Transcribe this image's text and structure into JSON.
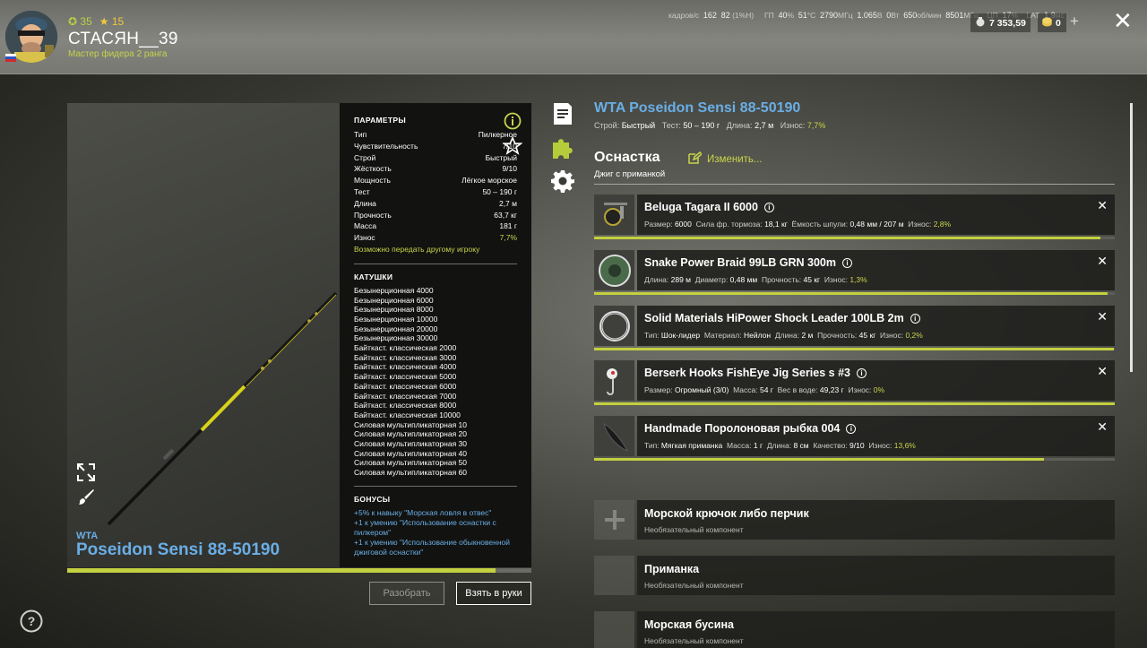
{
  "player": {
    "coins": "35",
    "stars": "15",
    "name": "СТАСЯН__39",
    "rank": "Мастер фидера 2 ранга"
  },
  "sysinfo": {
    "fps_label": "кадров/с",
    "fps": "162",
    "fps2": "82",
    "fps_extra": "(1%Н)",
    "gpu_label": "ГП",
    "gpu_load": "40",
    "gpu_temp": "51",
    "gpu_clock": "2790",
    "gpu_v": "1.065",
    "gpu_w": "0",
    "gpu_rpm": "650",
    "gpu_mem": "8501",
    "cpu_label": "ЦП",
    "cpu_load": "17",
    "lat_label": "LAT",
    "lat": "1.9"
  },
  "wallet": {
    "money": "7 353,59",
    "gold": "0",
    "plus": "+"
  },
  "rod": {
    "brand": "WTA",
    "name": "Poseidon Sensi 88-50190",
    "wear_fraction": 0.923
  },
  "params": {
    "title": "ПАРАМЕТРЫ",
    "rows": [
      {
        "k": "Тип",
        "v": "Пилкерное"
      },
      {
        "k": "Чувствительность",
        "v": "7/10"
      },
      {
        "k": "Строй",
        "v": "Быстрый"
      },
      {
        "k": "Жёсткость",
        "v": "9/10"
      },
      {
        "k": "Мощность",
        "v": "Лёгкое морское"
      },
      {
        "k": "Тест",
        "v": "50 – 190 г"
      },
      {
        "k": "Длина",
        "v": "2,7 м"
      },
      {
        "k": "Прочность",
        "v": "63,7 кг"
      },
      {
        "k": "Масса",
        "v": "181 г"
      },
      {
        "k": "Износ",
        "v": "7,7%"
      }
    ],
    "transfer": "Возможно передать другому игроку",
    "reels_title": "КАТУШКИ",
    "reels": [
      "Безынерционная 4000",
      "Безынерционная 6000",
      "Безынерционная 8000",
      "Безынерционная 10000",
      "Безынерционная 20000",
      "Безынерционная 30000",
      "Байткаст. классическая 2000",
      "Байткаст. классическая 3000",
      "Байткаст. классическая 4000",
      "Байткаст. классическая 5000",
      "Байткаст. классическая 6000",
      "Байткаст. классическая 7000",
      "Байткаст. классическая 8000",
      "Байткаст. классическая 10000",
      "Силовая мультипликаторная 10",
      "Силовая мультипликаторная 20",
      "Силовая мультипликаторная 30",
      "Силовая мультипликаторная 40",
      "Силовая мультипликаторная 50",
      "Силовая мультипликаторная 60"
    ],
    "bonus_title": "БОНУСЫ",
    "bonuses": [
      "+5% к навыку \"Морская ловля в отвес\"",
      "+1 к умению \"Использование оснастки с пилкером\"",
      "+1 к умению \"Использование обыкновенной джиговой оснастки\""
    ]
  },
  "buttons": {
    "disassemble": "Разобрать",
    "take": "Взять в руки"
  },
  "detail": {
    "title": "WTA Poseidon Sensi 88-50190",
    "action_label": "Строй:",
    "action": "Быстрый",
    "test_label": "Тест:",
    "test": "50 – 190 г",
    "len_label": "Длина:",
    "len": "2,7 м",
    "wear_label": "Износ:",
    "wear": "7,7%"
  },
  "rig": {
    "title": "Оснастка",
    "edit": "Изменить...",
    "subtitle": "Джиг с приманкой",
    "items": [
      {
        "name": "Beluga Tagara II 6000",
        "stats": [
          [
            "Размер:",
            "6000"
          ],
          [
            "Сила фр. тормоза:",
            "18,1 кг"
          ],
          [
            "Ёмкость шпули:",
            "0,48 мм / 207 м"
          ]
        ],
        "wear_label": "Износ:",
        "wear": "2,8%",
        "bar": 0.972,
        "icon": "reel-icon"
      },
      {
        "name": "Snake Power Braid 99LB GRN 300m",
        "stats": [
          [
            "Длина:",
            "289 м"
          ],
          [
            "Диаметр:",
            "0,48 мм"
          ],
          [
            "Прочность:",
            "45 кг"
          ]
        ],
        "wear_label": "Износ:",
        "wear": "1,3%",
        "bar": 0.987,
        "icon": "line-spool-icon"
      },
      {
        "name": "Solid Materials HiPower Shock Leader 100LB 2m",
        "stats": [
          [
            "Тип:",
            "Шок-лидер"
          ],
          [
            "Материал:",
            "Нейлон"
          ],
          [
            "Длина:",
            "2 м"
          ],
          [
            "Прочность:",
            "45 кг"
          ]
        ],
        "wear_label": "Износ:",
        "wear": "0,2%",
        "bar": 0.998,
        "icon": "leader-coil-icon"
      },
      {
        "name": "Berserk Hooks FishEye Jig Series s #3",
        "stats": [
          [
            "Размер:",
            "Огромный (3/0)"
          ],
          [
            "Масса:",
            "54 г"
          ],
          [
            "Вес в воде:",
            "49,23 г"
          ]
        ],
        "wear_label": "Износ:",
        "wear": "0%",
        "bar": 1.0,
        "icon": "jig-hook-icon"
      },
      {
        "name": "Handmade Поролоновая рыбка 004",
        "stats": [
          [
            "Тип:",
            "Мягкая приманка"
          ],
          [
            "Масса:",
            "1 г"
          ],
          [
            "Длина:",
            "8 см"
          ],
          [
            "Качество:",
            "9/10"
          ]
        ],
        "wear_label": "Износ:",
        "wear": "13,6%",
        "bar": 0.864,
        "icon": "foam-fish-icon"
      }
    ],
    "optional": [
      {
        "name": "Морской крючок либо перчик",
        "sub": "Необязательный компонент"
      },
      {
        "name": "Приманка",
        "sub": "Необязательный компонент"
      },
      {
        "name": "Морская бусина",
        "sub": "Необязательный компонент"
      }
    ]
  },
  "colors": {
    "accent_green": "#c3d03f",
    "accent_blue": "#6aaee6"
  }
}
